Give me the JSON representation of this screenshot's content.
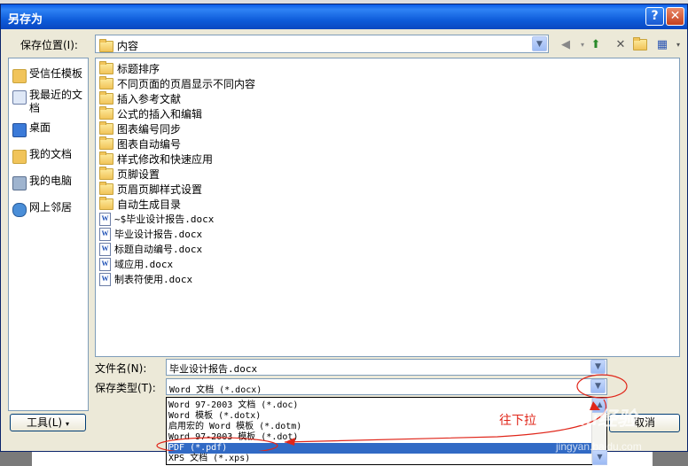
{
  "dialog": {
    "title": "另存为",
    "help_glyph": "?",
    "close_glyph": "✕"
  },
  "location": {
    "label": "保存位置(I):",
    "value": "内容"
  },
  "places": [
    {
      "label": "受信任模板",
      "icon": "trusted-templates-icon"
    },
    {
      "label": "我最近的文档",
      "icon": "recent-documents-icon"
    },
    {
      "label": "桌面",
      "icon": "desktop-icon"
    },
    {
      "label": "我的文档",
      "icon": "my-documents-icon"
    },
    {
      "label": "我的电脑",
      "icon": "my-computer-icon"
    },
    {
      "label": "网上邻居",
      "icon": "network-places-icon"
    }
  ],
  "files": [
    {
      "name": "标题排序",
      "type": "folder"
    },
    {
      "name": "不同页面的页眉显示不同内容",
      "type": "folder"
    },
    {
      "name": "插入参考文献",
      "type": "folder"
    },
    {
      "name": "公式的插入和编辑",
      "type": "folder"
    },
    {
      "name": "图表编号同步",
      "type": "folder"
    },
    {
      "name": "图表自动编号",
      "type": "folder"
    },
    {
      "name": "样式修改和快速应用",
      "type": "folder"
    },
    {
      "name": "页脚设置",
      "type": "folder"
    },
    {
      "name": "页眉页脚样式设置",
      "type": "folder"
    },
    {
      "name": "自动生成目录",
      "type": "folder"
    },
    {
      "name": "~$毕业设计报告.docx",
      "type": "word"
    },
    {
      "name": "毕业设计报告.docx",
      "type": "word"
    },
    {
      "name": "标题自动编号.docx",
      "type": "word"
    },
    {
      "name": "域应用.docx",
      "type": "word"
    },
    {
      "name": "制表符使用.docx",
      "type": "word"
    }
  ],
  "filename": {
    "label": "文件名(N):",
    "value": "毕业设计报告.docx"
  },
  "filetype": {
    "label": "保存类型(T):",
    "value": "Word 文档 (*.docx)",
    "options": [
      "Word 97-2003 文档 (*.doc)",
      "Word 模板 (*.dotx)",
      "启用宏的 Word 模板 (*.dotm)",
      "Word 97-2003 模板 (*.dot)",
      "PDF (*.pdf)",
      "XPS 文档 (*.xps)"
    ],
    "selected_option": "PDF (*.pdf)"
  },
  "buttons": {
    "tools": "工具(L)",
    "cancel": "取消"
  },
  "annotation": {
    "text": "往下拉",
    "color": "#e0261a"
  },
  "watermark": {
    "brand": "Baidu经验",
    "url": "jingyan.baidu.com"
  },
  "colors": {
    "titlebar": "#0a5ce8",
    "dialog_bg": "#ece9d8",
    "selection": "#316ac5"
  }
}
